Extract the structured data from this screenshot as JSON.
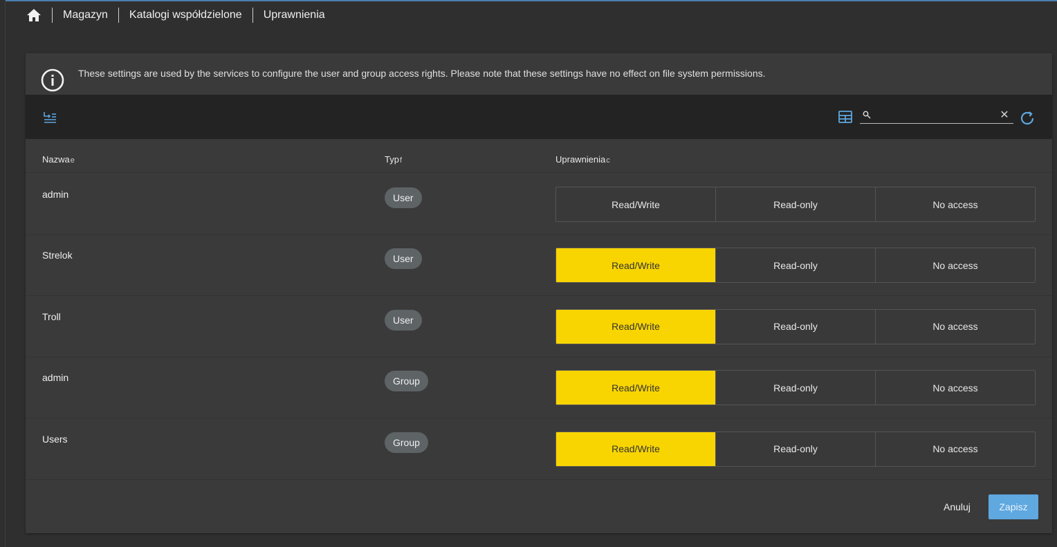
{
  "breadcrumb": {
    "home_icon": "home-icon",
    "items": [
      "Magazyn",
      "Katalogi współdzielone",
      "Uprawnienia"
    ]
  },
  "info": {
    "icon": "info-icon",
    "text": "These settings are used by the services to configure the user and group access rights. Please note that these settings have no effect on file system permissions."
  },
  "toolbar": {
    "left_icon": "batch-edit-icon",
    "grid_icon": "table-columns-icon",
    "search_icon": "search-icon",
    "search_value": "",
    "clear_icon": "close-icon",
    "clear_glyph": "✕",
    "refresh_icon": "refresh-icon"
  },
  "table": {
    "columns": [
      {
        "label": "Nazwa",
        "sort_glyph": "e"
      },
      {
        "label": "Typ",
        "sort_glyph": "f"
      },
      {
        "label": "Uprawnienia",
        "sort_glyph": "c"
      }
    ],
    "permission_options": [
      "Read/Write",
      "Read-only",
      "No access"
    ],
    "rows": [
      {
        "name": "admin",
        "type": "User",
        "permission": null
      },
      {
        "name": "Strelok",
        "type": "User",
        "permission": "Read/Write"
      },
      {
        "name": "Troll",
        "type": "User",
        "permission": "Read/Write"
      },
      {
        "name": "admin",
        "type": "Group",
        "permission": "Read/Write"
      },
      {
        "name": "Users",
        "type": "Group",
        "permission": "Read/Write"
      }
    ]
  },
  "footer": {
    "cancel_label": "Anuluj",
    "save_label": "Zapisz"
  },
  "colors": {
    "accent": "#5fa8e0",
    "active_segment": "#f8d500",
    "badge": "#5e6366",
    "toolbar_bg": "#232323",
    "card_bg": "#3a3a3a"
  }
}
